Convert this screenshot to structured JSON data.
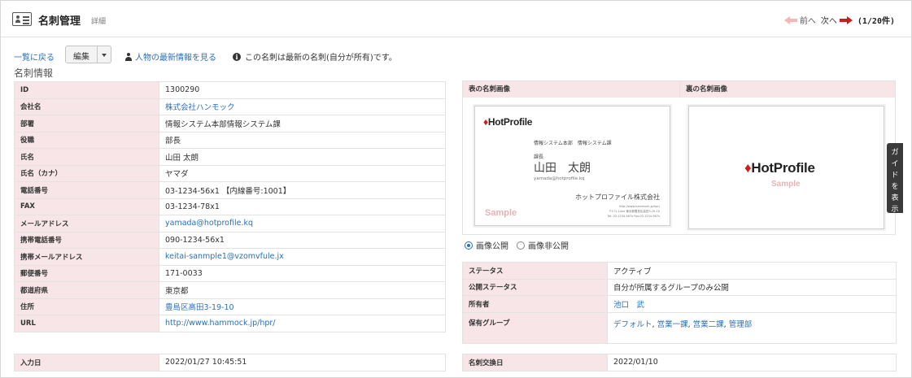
{
  "header": {
    "title": "名刺管理",
    "subtitle": "詳細",
    "pager": {
      "prev_label": "前へ",
      "next_label": "次へ",
      "count": "(1/20件)"
    }
  },
  "actions": {
    "back_label": "一覧に戻る",
    "edit_label": "編集",
    "latest_label": "人物の最新情報を見る",
    "info_text": "この名刺は最新の名刺(自分が所有)です。"
  },
  "section_title": "名刺情報",
  "card_info": [
    {
      "key": "ID",
      "value": "1300290"
    },
    {
      "key": "会社名",
      "value": "株式会社ハンモック"
    },
    {
      "key": "部署",
      "value": "情報システム本部情報システム課"
    },
    {
      "key": "役職",
      "value": "部長"
    },
    {
      "key": "氏名",
      "value": "山田 太朗"
    },
    {
      "key": "氏名（カナ）",
      "value": "ヤマダ"
    },
    {
      "key": "電話番号",
      "value": "03-1234-56x1 【内線番号:1001】"
    },
    {
      "key": "FAX",
      "value": "03-1234-78x1"
    },
    {
      "key": "メールアドレス",
      "value": "yamada@hotprofile.kq"
    },
    {
      "key": "携帯電話番号",
      "value": "090-1234-56x1"
    },
    {
      "key": "携帯メールアドレス",
      "value": "keitai-sanmple1@vzomvfule.jx"
    },
    {
      "key": "郵便番号",
      "value": "171-0033"
    },
    {
      "key": "都道府県",
      "value": "東京都"
    },
    {
      "key": "住所",
      "value": "豊島区高田3-19-10"
    },
    {
      "key": "URL",
      "value": "http://www.hammock.jp/hpr/"
    }
  ],
  "input_date": {
    "key": "入力日",
    "value": "2022/01/27 10:45:51"
  },
  "images": {
    "front_header": "表の名刺画像",
    "back_header": "裏の名刺画像",
    "front_card": {
      "logo_text": "HotProfile",
      "dept": "情報システム本部　情報システム課",
      "title": "課長",
      "name": "山田　太朗",
      "email": "yamada@hotprofile.kq",
      "company": "ホットプロファイル株式会社",
      "url": "http://www.hammock.jp/hpr/",
      "address": "〒171-14xx 東京都豊島区高田3-19-10",
      "tel": "Tel: 03-1234-567x  Fax:03-1234-567x",
      "sample": "Sample"
    },
    "back_card": {
      "logo_text": "HotProfile",
      "sample": "Sample"
    }
  },
  "visibility": {
    "public_label": "画像公開",
    "private_label": "画像非公開",
    "selected": "public"
  },
  "status_info": [
    {
      "key": "ステータス",
      "value": "アクティブ"
    },
    {
      "key": "公開ステータス",
      "value": "自分が所属するグループのみ公開"
    },
    {
      "key": "所有者",
      "value": "池口　武"
    }
  ],
  "groups": {
    "key": "保有グループ",
    "items": [
      "デフォルト",
      "営業一課",
      "営業二課",
      "管理部"
    ]
  },
  "exchange_date": {
    "key": "名刺交換日",
    "value": "2022/01/10"
  },
  "guide_label": [
    "ガ",
    "イ",
    "ド",
    "を",
    "表",
    "示"
  ],
  "colors": {
    "accent_link": "#2a6fb7",
    "label_bg": "#f7e5e7",
    "next_arrow": "#c81e1e",
    "prev_arrow": "#f4b6b6",
    "logo_drop": "#d31b1b"
  }
}
